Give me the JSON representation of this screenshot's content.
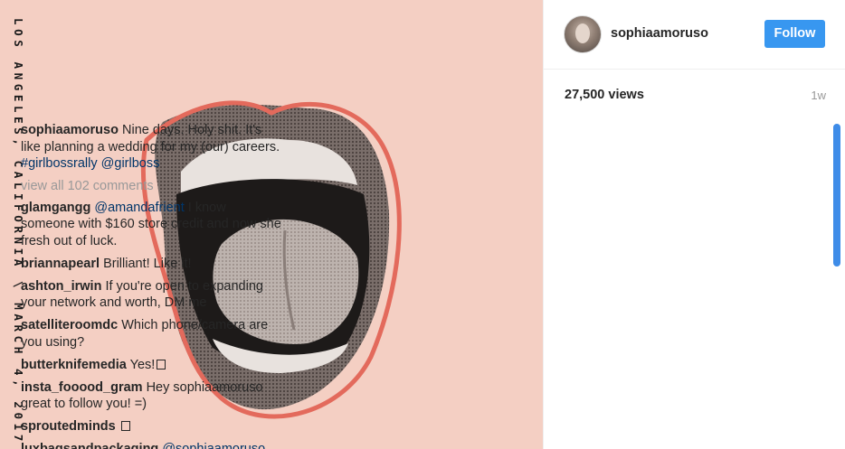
{
  "media": {
    "vertical_text": "LOS ANGELES, CALIFORNIA \\ MARCH 4, 2017"
  },
  "header": {
    "username": "sophiaamoruso",
    "follow_label": "Follow"
  },
  "stats": {
    "views": "27,500 views",
    "time": "1w"
  },
  "caption": {
    "user": "sophiaamoruso",
    "text": "Nine days. Holy shit. It's like planning a wedding for my (our) careers.",
    "hashtag": "#girlbossrally",
    "mention": "@girlboss"
  },
  "view_all": "view all 102 comments",
  "comments": [
    {
      "user": "glamgangg",
      "mention": "@amandafrient",
      "text": "I know someone with $160 store credit and now she fresh out of luck."
    },
    {
      "user": "briannapearl",
      "text": "Brilliant! Like it!"
    },
    {
      "user": "ashton_irwin",
      "text": "If you're open to expanding your network and worth, DM me"
    },
    {
      "user": "satelliteroomdc",
      "text": "Which phone/camera are you using?"
    },
    {
      "user": "butterknifemedia",
      "text": "Yes!",
      "emoji": true
    },
    {
      "user": "insta_fooood_gram",
      "text": "Hey sophiaamoruso great to follow you! =)"
    },
    {
      "user": "sproutedminds",
      "text": "",
      "emoji": true
    },
    {
      "user": "luxbagsandpackaging",
      "mention": "@sophiaamoruso",
      "text": ""
    }
  ]
}
